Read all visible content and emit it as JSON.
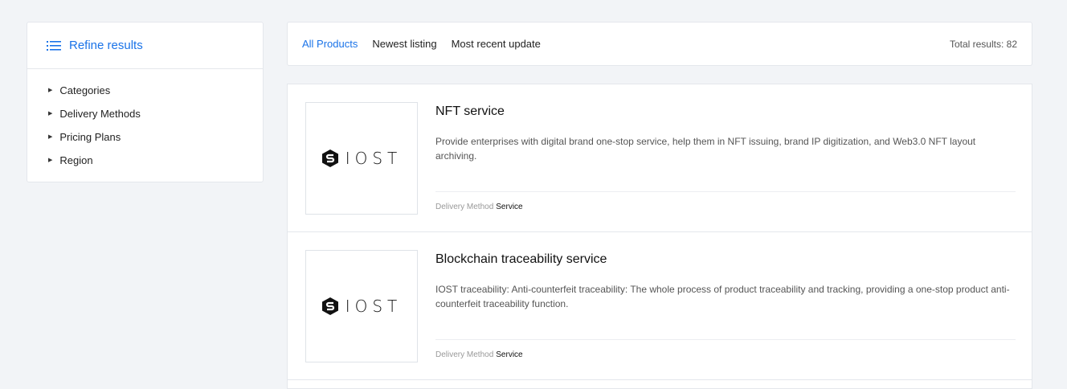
{
  "sidebar": {
    "title": "Refine results",
    "icon": "list-icon",
    "filters": [
      "Categories",
      "Delivery Methods",
      "Pricing Plans",
      "Region"
    ]
  },
  "tabs": {
    "items": [
      "All Products",
      "Newest listing",
      "Most recent update"
    ],
    "active": "All Products",
    "total": "Total results: 82"
  },
  "products": [
    {
      "name": "NFT service",
      "description": "Provide enterprises with digital brand one-stop service, help them in NFT issuing, brand IP digitization, and Web3.0 NFT layout archiving.",
      "logo_text": "IOST",
      "meta_label": "Delivery Method",
      "meta_value": "Service"
    },
    {
      "name": "Blockchain traceability service",
      "description": "IOST traceability: Anti-counterfeit traceability: The whole process of product traceability and tracking, providing a one-stop product anti-counterfeit traceability function.",
      "logo_text": "IOST",
      "meta_label": "Delivery Method",
      "meta_value": "Service"
    }
  ],
  "colors": {
    "accent": "#1a73e8",
    "background": "#f2f4f7"
  }
}
